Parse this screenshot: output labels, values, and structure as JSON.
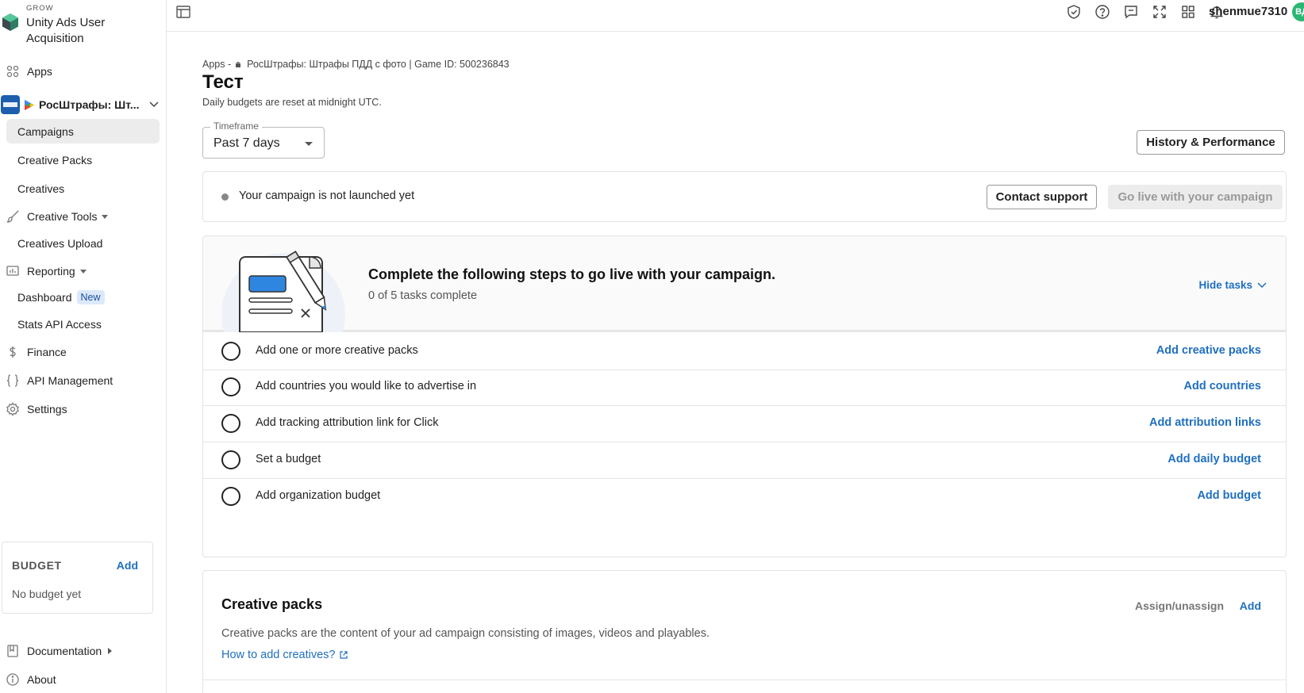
{
  "brand": {
    "small_label": "GROW",
    "title": "Unity Ads User Acquisition"
  },
  "sidebar": {
    "apps": "Apps",
    "app_name": "РосШтрафы: Шт...",
    "campaigns": "Campaigns",
    "creative_packs": "Creative Packs",
    "creatives": "Creatives",
    "creative_tools": "Creative Tools",
    "creatives_upload": "Creatives Upload",
    "reporting": "Reporting",
    "dashboard": "Dashboard",
    "dashboard_badge": "New",
    "stats_api": "Stats API Access",
    "finance": "Finance",
    "api_management": "API Management",
    "settings": "Settings",
    "documentation": "Documentation",
    "about": "About"
  },
  "budget": {
    "title": "BUDGET",
    "add": "Add",
    "empty": "No budget yet"
  },
  "topbar": {
    "username": "shenmue7310",
    "avatar_initials": "ВД"
  },
  "breadcrumb": {
    "apps": "Apps",
    "separator": "-",
    "app": "РосШтрафы: Штрафы ПДД с фото",
    "game_id": "| Game ID: 500236843"
  },
  "page": {
    "title": "Тест",
    "subtitle": "Daily budgets are reset at midnight UTC."
  },
  "timeframe": {
    "label": "Timeframe",
    "value": "Past 7 days"
  },
  "history_button": "History & Performance",
  "status": {
    "text": "Your campaign is not launched yet",
    "contact": "Contact support",
    "go_live": "Go live with your campaign"
  },
  "steps": {
    "title": "Complete the following steps to go live with your campaign.",
    "progress": "0 of 5 tasks complete",
    "hide": "Hide tasks",
    "tasks": [
      {
        "label": "Add one or more creative packs",
        "action": "Add creative packs"
      },
      {
        "label": "Add countries you would like to advertise in",
        "action": "Add countries"
      },
      {
        "label": "Add tracking attribution link for Click",
        "action": "Add attribution links"
      },
      {
        "label": "Set a budget",
        "action": "Add daily budget"
      },
      {
        "label": "Add organization budget",
        "action": "Add budget"
      }
    ]
  },
  "creative_packs": {
    "title": "Creative packs",
    "assign": "Assign/unassign",
    "add": "Add",
    "description": "Creative packs are the content of your ad campaign consisting of images, videos and playables.",
    "help_link": "How to add creatives?"
  },
  "colors": {
    "link": "#1f6fc0",
    "avatar": "#2bb673",
    "active_nav": "#ececec"
  }
}
